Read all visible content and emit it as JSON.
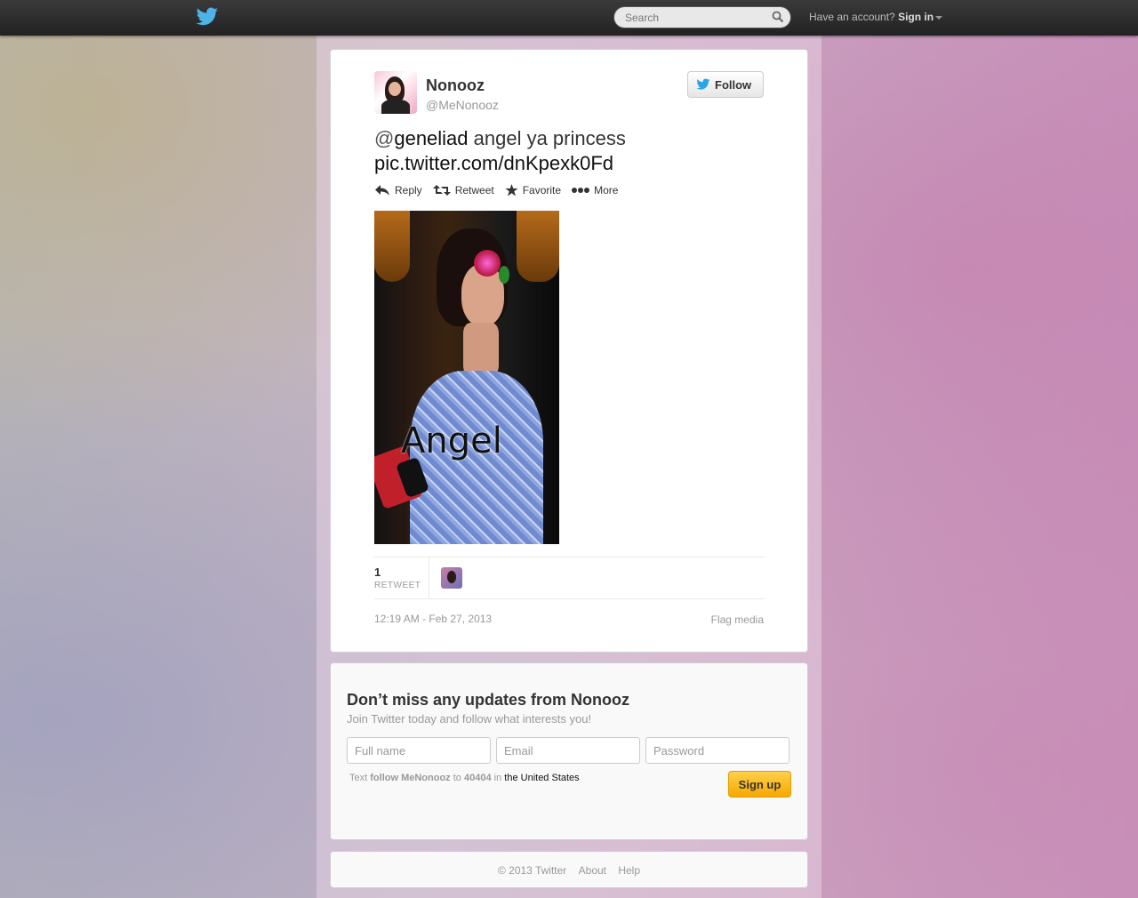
{
  "topbar": {
    "logo_icon": "twitter-bird-icon",
    "search_placeholder": "Search",
    "search_icon": "search-icon",
    "signin_prompt": "Have an account?",
    "signin_label": "Sign in"
  },
  "tweet": {
    "fullname": "Nonooz",
    "username": "@MeNonooz",
    "follow_label": "Follow",
    "text": {
      "mention_at": "@",
      "mention_name": "geneliad",
      "body": " angel ya princess ",
      "pic_link": "pic.twitter.com/dnKpexk0Fd"
    },
    "actions": {
      "reply": "Reply",
      "retweet": "Retweet",
      "favorite": "Favorite",
      "more": "More"
    },
    "photo_caption": "Angel",
    "retweet_count": "1",
    "retweet_label": "RETWEET",
    "timestamp": "12:19 AM - Feb 27, 2013",
    "flag_media": "Flag media"
  },
  "signup": {
    "title": "Don’t miss any updates from Nonooz",
    "subtitle": "Join Twitter today and follow what interests you!",
    "fullname_placeholder": "Full name",
    "email_placeholder": "Email",
    "password_placeholder": "Password",
    "sms_text": "Text",
    "sms_command": "follow MeNonooz",
    "sms_to": "to",
    "sms_number": "40404",
    "sms_in": "in",
    "sms_country": "the United States",
    "button_label": "Sign up"
  },
  "footer": {
    "copyright": "© 2013 Twitter",
    "about": "About",
    "help": "Help"
  },
  "colors": {
    "topbar": "#2b2b2b",
    "signup_button": "#f6b800",
    "link_text": "#111111"
  }
}
